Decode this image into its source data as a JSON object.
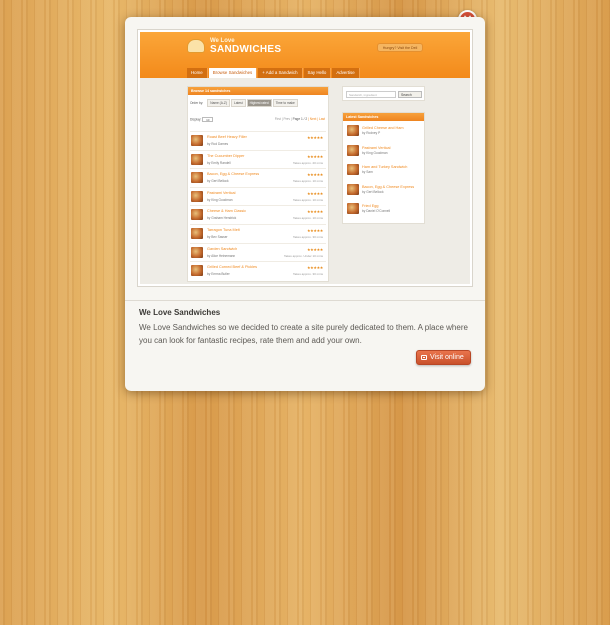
{
  "modal": {
    "close_glyph": "×",
    "project_title": "We Love Sandwiches",
    "project_description": "We Love Sandwiches so we decided to create a site purely dedicated to them. A place where you can look for fantastic recipes, rate them and add your own.",
    "visit_label": "Visit online"
  },
  "screenshot": {
    "logo_top": "We Love",
    "logo_bottom": "SANDWICHES",
    "header_pill": "Hungry? Visit the Deli",
    "nav": [
      "Home",
      "Browse Sandwiches",
      "+ Add a Sandwich",
      "Say Hello",
      "Advertise"
    ],
    "nav_active_index": 1,
    "main_heading": "Browse 14 sandwiches",
    "order_label": "Order by:",
    "order_options": [
      "Name (A-Z)",
      "Latest",
      "Highest rated",
      "Time to make"
    ],
    "order_selected_index": 2,
    "display_label": "Display:",
    "display_value": "10",
    "pagination_prev": "First | Prev |",
    "pagination_page": "Page 1 / 2",
    "pagination_next": "| Next | Last",
    "sandwiches": [
      {
        "title": "Roast Beef Heavy Filler",
        "by": "by Rod Dames",
        "stars": "★★★★★",
        "time": ""
      },
      {
        "title": "The Cucumber Dipper",
        "by": "by Emily Randell",
        "stars": "★★★★★",
        "time": "Takes approx. 20 mins"
      },
      {
        "title": "Bacon, Egg & Cheese Express",
        "by": "by Gert Bellock",
        "stars": "★★★★★",
        "time": "Takes approx. 10 mins"
      },
      {
        "title": "Pastrami Vertical",
        "by": "by King Goodman",
        "stars": "★★★★★",
        "time": "Takes approx. 10 mins"
      },
      {
        "title": "Cheese & Ham Classic",
        "by": "by Graham Hendrick",
        "stars": "★★★★★",
        "time": "Takes approx. 10 mins"
      },
      {
        "title": "Tarragon Tuna Melt",
        "by": "by Bev Sasser",
        "stars": "★★★★★",
        "time": "Takes approx. 30 mins"
      },
      {
        "title": "Garden Sandwich",
        "by": "by Alice Heinemann",
        "stars": "★★★★★",
        "time": "Takes approx. Under 10 mins"
      },
      {
        "title": "Grilled Corned Beef & Pickles",
        "by": "by Emma Butler",
        "stars": "★★★★★",
        "time": "Takes approx. 30 mins"
      }
    ],
    "search_placeholder": "Sandwich, ingredient",
    "search_button": "Search",
    "latest_heading": "Latest Sandwiches",
    "latest": [
      {
        "title": "Grilled Cheese and Ham",
        "by": "by Rodney P"
      },
      {
        "title": "Pastrami Vertical",
        "by": "by King Goodman"
      },
      {
        "title": "Ham and Turkey Sandwich",
        "by": "by Sam"
      },
      {
        "title": "Bacon, Egg & Cheese Express",
        "by": "by Gert Bellock"
      },
      {
        "title": "Fried Egg",
        "by": "by Daniel O'Connell"
      }
    ]
  }
}
